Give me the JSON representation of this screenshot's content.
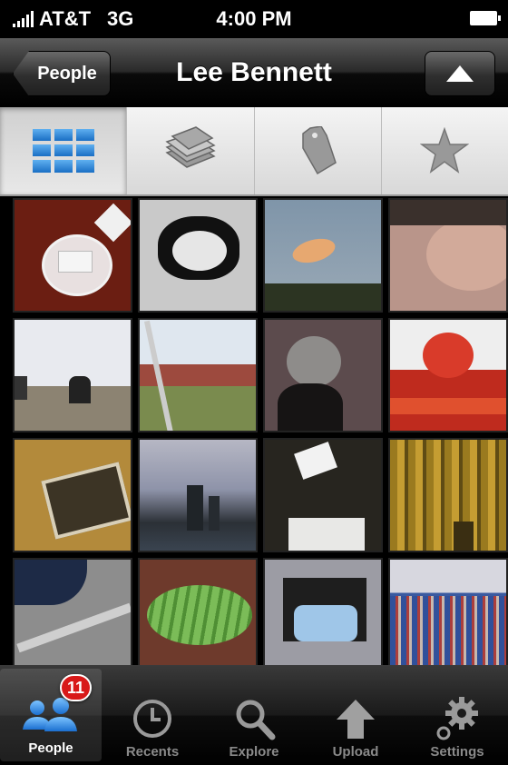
{
  "status": {
    "carrier": "AT&T",
    "network": "3G",
    "time": "4:00 PM"
  },
  "navbar": {
    "back_label": "People",
    "title": "Lee Bennett"
  },
  "segments": [
    {
      "icon": "grid-icon",
      "active": true
    },
    {
      "icon": "stack-icon",
      "active": false
    },
    {
      "icon": "tag-icon",
      "active": false
    },
    {
      "icon": "star-icon",
      "active": false
    }
  ],
  "photos": [
    "red-plate-photo",
    "lens-hood-photo",
    "sky-bird-photo",
    "face-closeup-photo",
    "meeting-room-photo",
    "building-exterior-photo",
    "plant-photo",
    "entrance-sign-photo",
    "wall-plaque-photo",
    "city-skyline-photo",
    "box-photo",
    "curtain-photo",
    "car-parking-photo",
    "gourd-photo",
    "projector-photo",
    "audience-photo"
  ],
  "tabbar": {
    "items": [
      {
        "label": "People",
        "icon": "people-icon",
        "active": true,
        "badge": "11"
      },
      {
        "label": "Recents",
        "icon": "clock-icon",
        "active": false
      },
      {
        "label": "Explore",
        "icon": "search-icon",
        "active": false
      },
      {
        "label": "Upload",
        "icon": "upload-arrow-icon",
        "active": false
      },
      {
        "label": "Settings",
        "icon": "gear-icon",
        "active": false
      }
    ]
  }
}
